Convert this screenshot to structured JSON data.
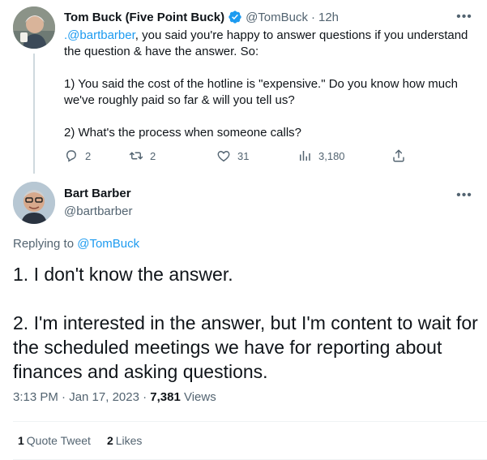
{
  "parent_tweet": {
    "display_name": "Tom Buck (Five Point Buck)",
    "handle": "@TomBuck",
    "separator": "·",
    "time": "12h",
    "more_icon": "•••",
    "mention": ".@bartbarber",
    "text_rest": ", you said you're happy to answer questions if you understand the question & have the answer. So:\n\n1) You said the cost of the hotline is \"expensive.\" Do you know how much we've roughly paid so far & will you tell us?\n\n2) What's the process when someone calls?",
    "actions": {
      "replies": "2",
      "retweets": "2",
      "likes": "31",
      "views": "3,180"
    },
    "icons": [
      "reply-icon",
      "retweet-icon",
      "like-icon",
      "views-icon",
      "share-icon",
      "verified-icon"
    ]
  },
  "main_tweet": {
    "display_name": "Bart Barber",
    "handle": "@bartbarber",
    "more_icon": "•••",
    "replying_prefix": "Replying to ",
    "replying_to": "@TomBuck",
    "text": "1. I don't know the answer.\n\n2. I'm interested in the answer, but I'm content to wait for the scheduled meetings we have for reporting about finances and asking questions.",
    "timestamp": "3:13 PM · Jan 17, 2023 · ",
    "views_count": "7,381",
    "views_label": " Views",
    "quote_count": "1",
    "quote_label": "Quote Tweet",
    "like_count": "2",
    "like_label": "Likes"
  },
  "colors": {
    "accent": "#1d9bf0",
    "muted": "#536471",
    "text": "#0f1419",
    "divider": "#eff3f4"
  }
}
